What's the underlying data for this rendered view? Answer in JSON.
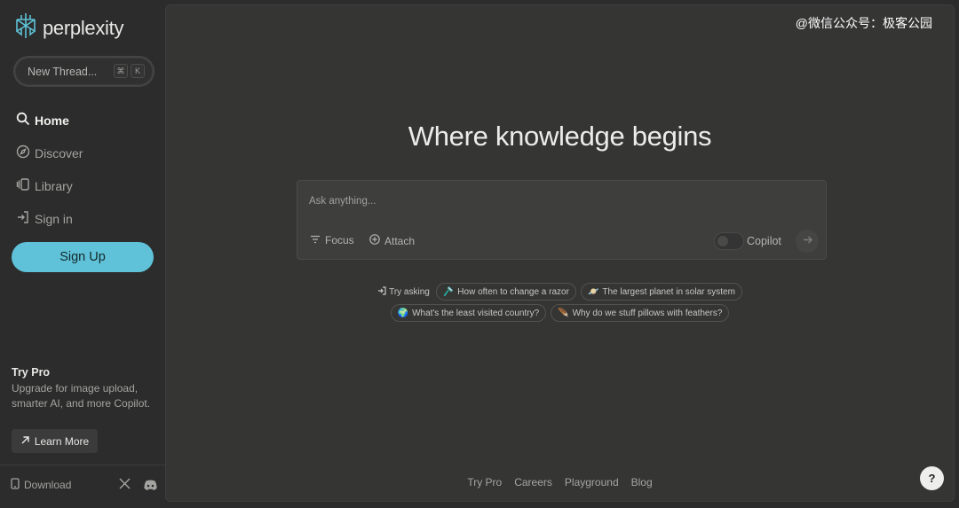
{
  "brand": {
    "name": "perplexity",
    "accent": "#5fc2d8"
  },
  "sidebar": {
    "new_thread": {
      "label": "New Thread...",
      "shortcut": [
        "⌘",
        "K"
      ]
    },
    "nav": [
      {
        "label": "Home",
        "icon": "search-icon",
        "active": true
      },
      {
        "label": "Discover",
        "icon": "compass-icon",
        "active": false
      },
      {
        "label": "Library",
        "icon": "library-icon",
        "active": false
      },
      {
        "label": "Sign in",
        "icon": "sign-in-icon",
        "active": false
      }
    ],
    "signup_label": "Sign Up",
    "try_pro": {
      "title": "Try Pro",
      "description": "Upgrade for image upload, smarter AI, and more Copilot.",
      "learn_more": "Learn More"
    },
    "footer": {
      "download": "Download"
    }
  },
  "watermark": "@微信公众号：极客公园",
  "main": {
    "headline": "Where knowledge begins",
    "ask": {
      "placeholder": "Ask anything...",
      "focus": "Focus",
      "attach": "Attach",
      "copilot": "Copilot"
    },
    "try_asking": "Try asking",
    "suggestions_row1": [
      {
        "emoji": "🪒",
        "text": "How often to change a razor"
      },
      {
        "emoji": "🪐",
        "text": "The largest planet in solar system"
      }
    ],
    "suggestions_row2": [
      {
        "emoji": "🌍",
        "text": "What's the least visited country?"
      },
      {
        "emoji": "🪶",
        "text": "Why do we stuff pillows with feathers?"
      }
    ],
    "footer_links": [
      "Try Pro",
      "Careers",
      "Playground",
      "Blog"
    ],
    "help": "?"
  }
}
